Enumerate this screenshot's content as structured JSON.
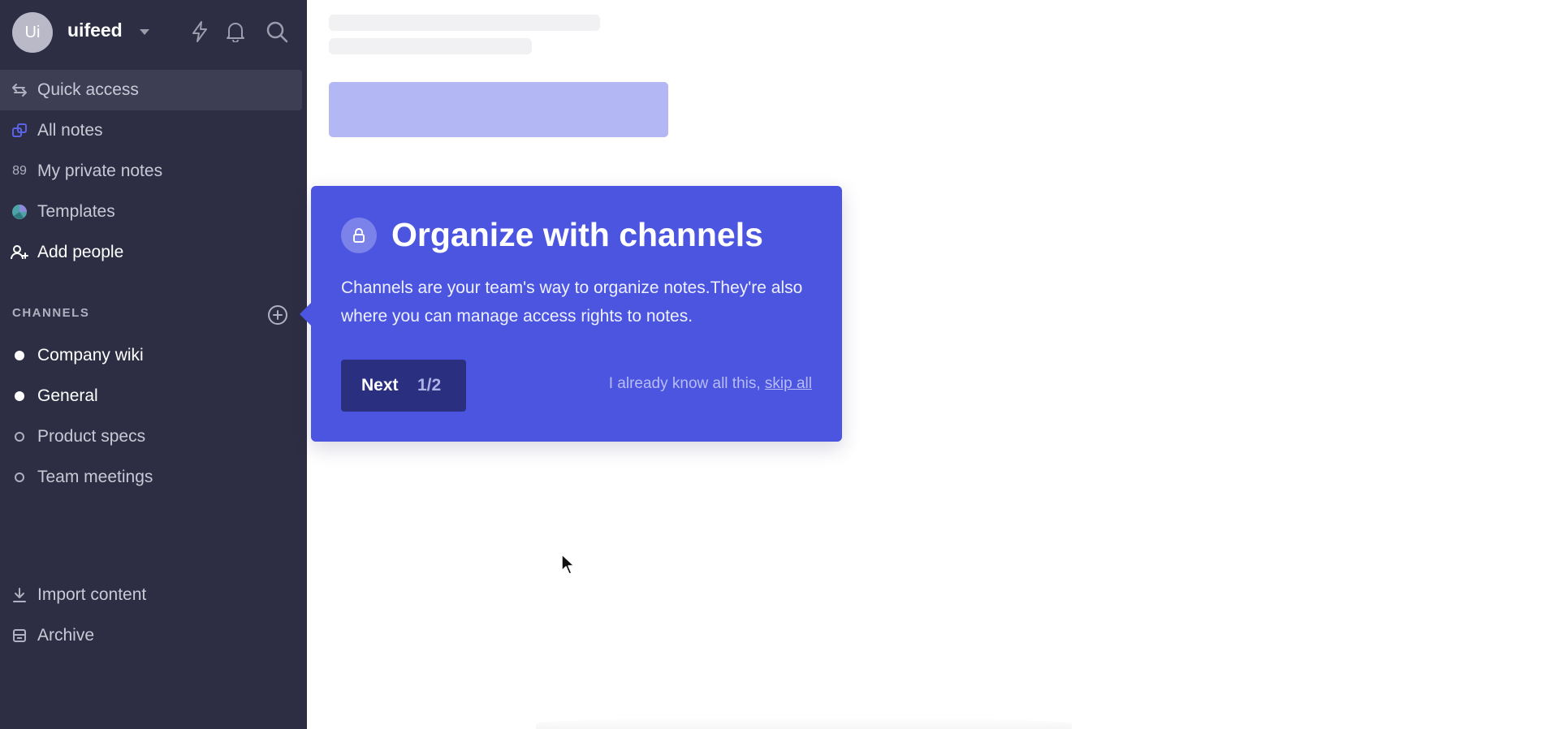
{
  "workspace": {
    "avatar_initials": "Ui",
    "name": "uifeed"
  },
  "topbar_icons": [
    "lightning-icon",
    "bell-icon",
    "search-icon"
  ],
  "nav": {
    "quick_access": "Quick access",
    "all_notes": "All notes",
    "private_notes_count": "89",
    "private_notes": "My private notes",
    "templates": "Templates",
    "add_people": "Add people"
  },
  "channels": {
    "header": "CHANNELS",
    "items": [
      {
        "label": "Company wiki",
        "dot": "filled"
      },
      {
        "label": "General",
        "dot": "filled"
      },
      {
        "label": "Product specs",
        "dot": "hollow"
      },
      {
        "label": "Team meetings",
        "dot": "hollow"
      }
    ]
  },
  "footer_nav": {
    "import": "Import content",
    "archive": "Archive"
  },
  "tour": {
    "title": "Organize with channels",
    "body": "Channels are your team's way to organize notes.They're also where you can manage access rights to notes.",
    "next_label": "Next",
    "step": "1/2",
    "skip_prefix": "I already know all this, ",
    "skip_link": "skip all"
  },
  "colors": {
    "sidebar_bg": "#2d2e43",
    "accent": "#4b55e0",
    "skeleton_button": "#b3b7f4"
  }
}
